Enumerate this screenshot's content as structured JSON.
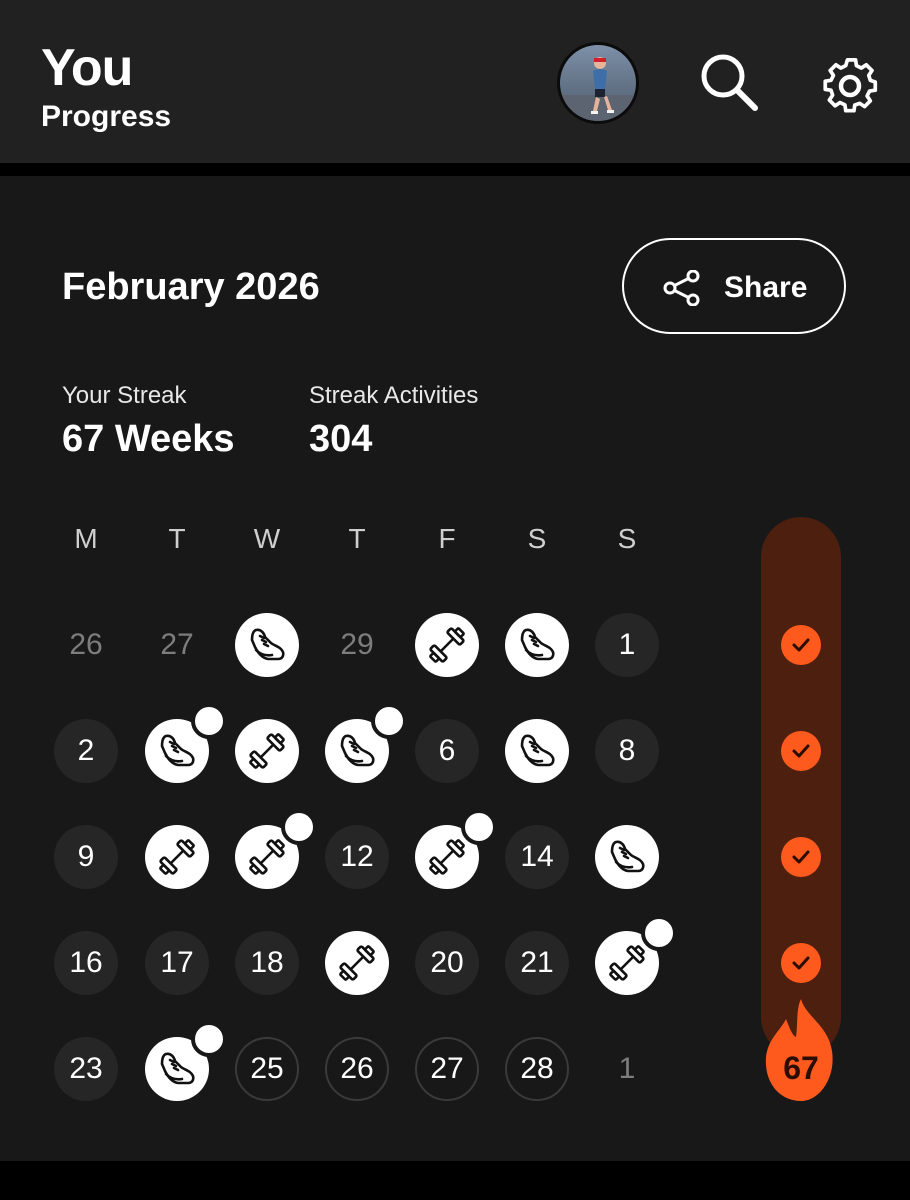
{
  "header": {
    "title": "You",
    "subtitle": "Progress"
  },
  "calendar": {
    "month": "February 2026",
    "share_label": "Share",
    "stats": [
      {
        "label": "Your Streak",
        "value": "67 Weeks"
      },
      {
        "label": "Streak Activities",
        "value": "304"
      }
    ],
    "weekdays": [
      "M",
      "T",
      "W",
      "T",
      "F",
      "S",
      "S"
    ],
    "weeks": [
      [
        {
          "t": "26",
          "k": "dim"
        },
        {
          "t": "27",
          "k": "dim"
        },
        {
          "k": "run"
        },
        {
          "t": "29",
          "k": "dim"
        },
        {
          "k": "weights"
        },
        {
          "k": "run"
        },
        {
          "t": "1",
          "k": "plain"
        }
      ],
      [
        {
          "t": "2",
          "k": "plain"
        },
        {
          "k": "run",
          "badge": true
        },
        {
          "k": "weights"
        },
        {
          "k": "run",
          "badge": true
        },
        {
          "t": "6",
          "k": "plain"
        },
        {
          "k": "run"
        },
        {
          "t": "8",
          "k": "plain"
        }
      ],
      [
        {
          "t": "9",
          "k": "plain"
        },
        {
          "k": "weights"
        },
        {
          "k": "weights",
          "badge": true
        },
        {
          "t": "12",
          "k": "plain"
        },
        {
          "k": "weights",
          "badge": true
        },
        {
          "t": "14",
          "k": "plain"
        },
        {
          "k": "run"
        }
      ],
      [
        {
          "t": "16",
          "k": "plain"
        },
        {
          "t": "17",
          "k": "plain"
        },
        {
          "t": "18",
          "k": "plain"
        },
        {
          "k": "weights"
        },
        {
          "t": "20",
          "k": "plain"
        },
        {
          "t": "21",
          "k": "plain"
        },
        {
          "k": "weights",
          "badge": true
        }
      ],
      [
        {
          "t": "23",
          "k": "plain"
        },
        {
          "k": "run",
          "badge": true
        },
        {
          "t": "25",
          "k": "future"
        },
        {
          "t": "26",
          "k": "future"
        },
        {
          "t": "27",
          "k": "future"
        },
        {
          "t": "28",
          "k": "future"
        },
        {
          "t": "1",
          "k": "dim"
        }
      ]
    ],
    "weeks_completed": [
      true,
      true,
      true,
      true
    ],
    "streak_count": "67"
  },
  "colors": {
    "accent": "#ff5a1e",
    "streak_bar": "#4c1f0e",
    "card": "#181818",
    "header": "#212121"
  },
  "icons": [
    "avatar",
    "search-icon",
    "gear-icon",
    "share-icon",
    "run-shoe-icon",
    "dumbbell-icon",
    "check-icon",
    "flame-icon"
  ]
}
